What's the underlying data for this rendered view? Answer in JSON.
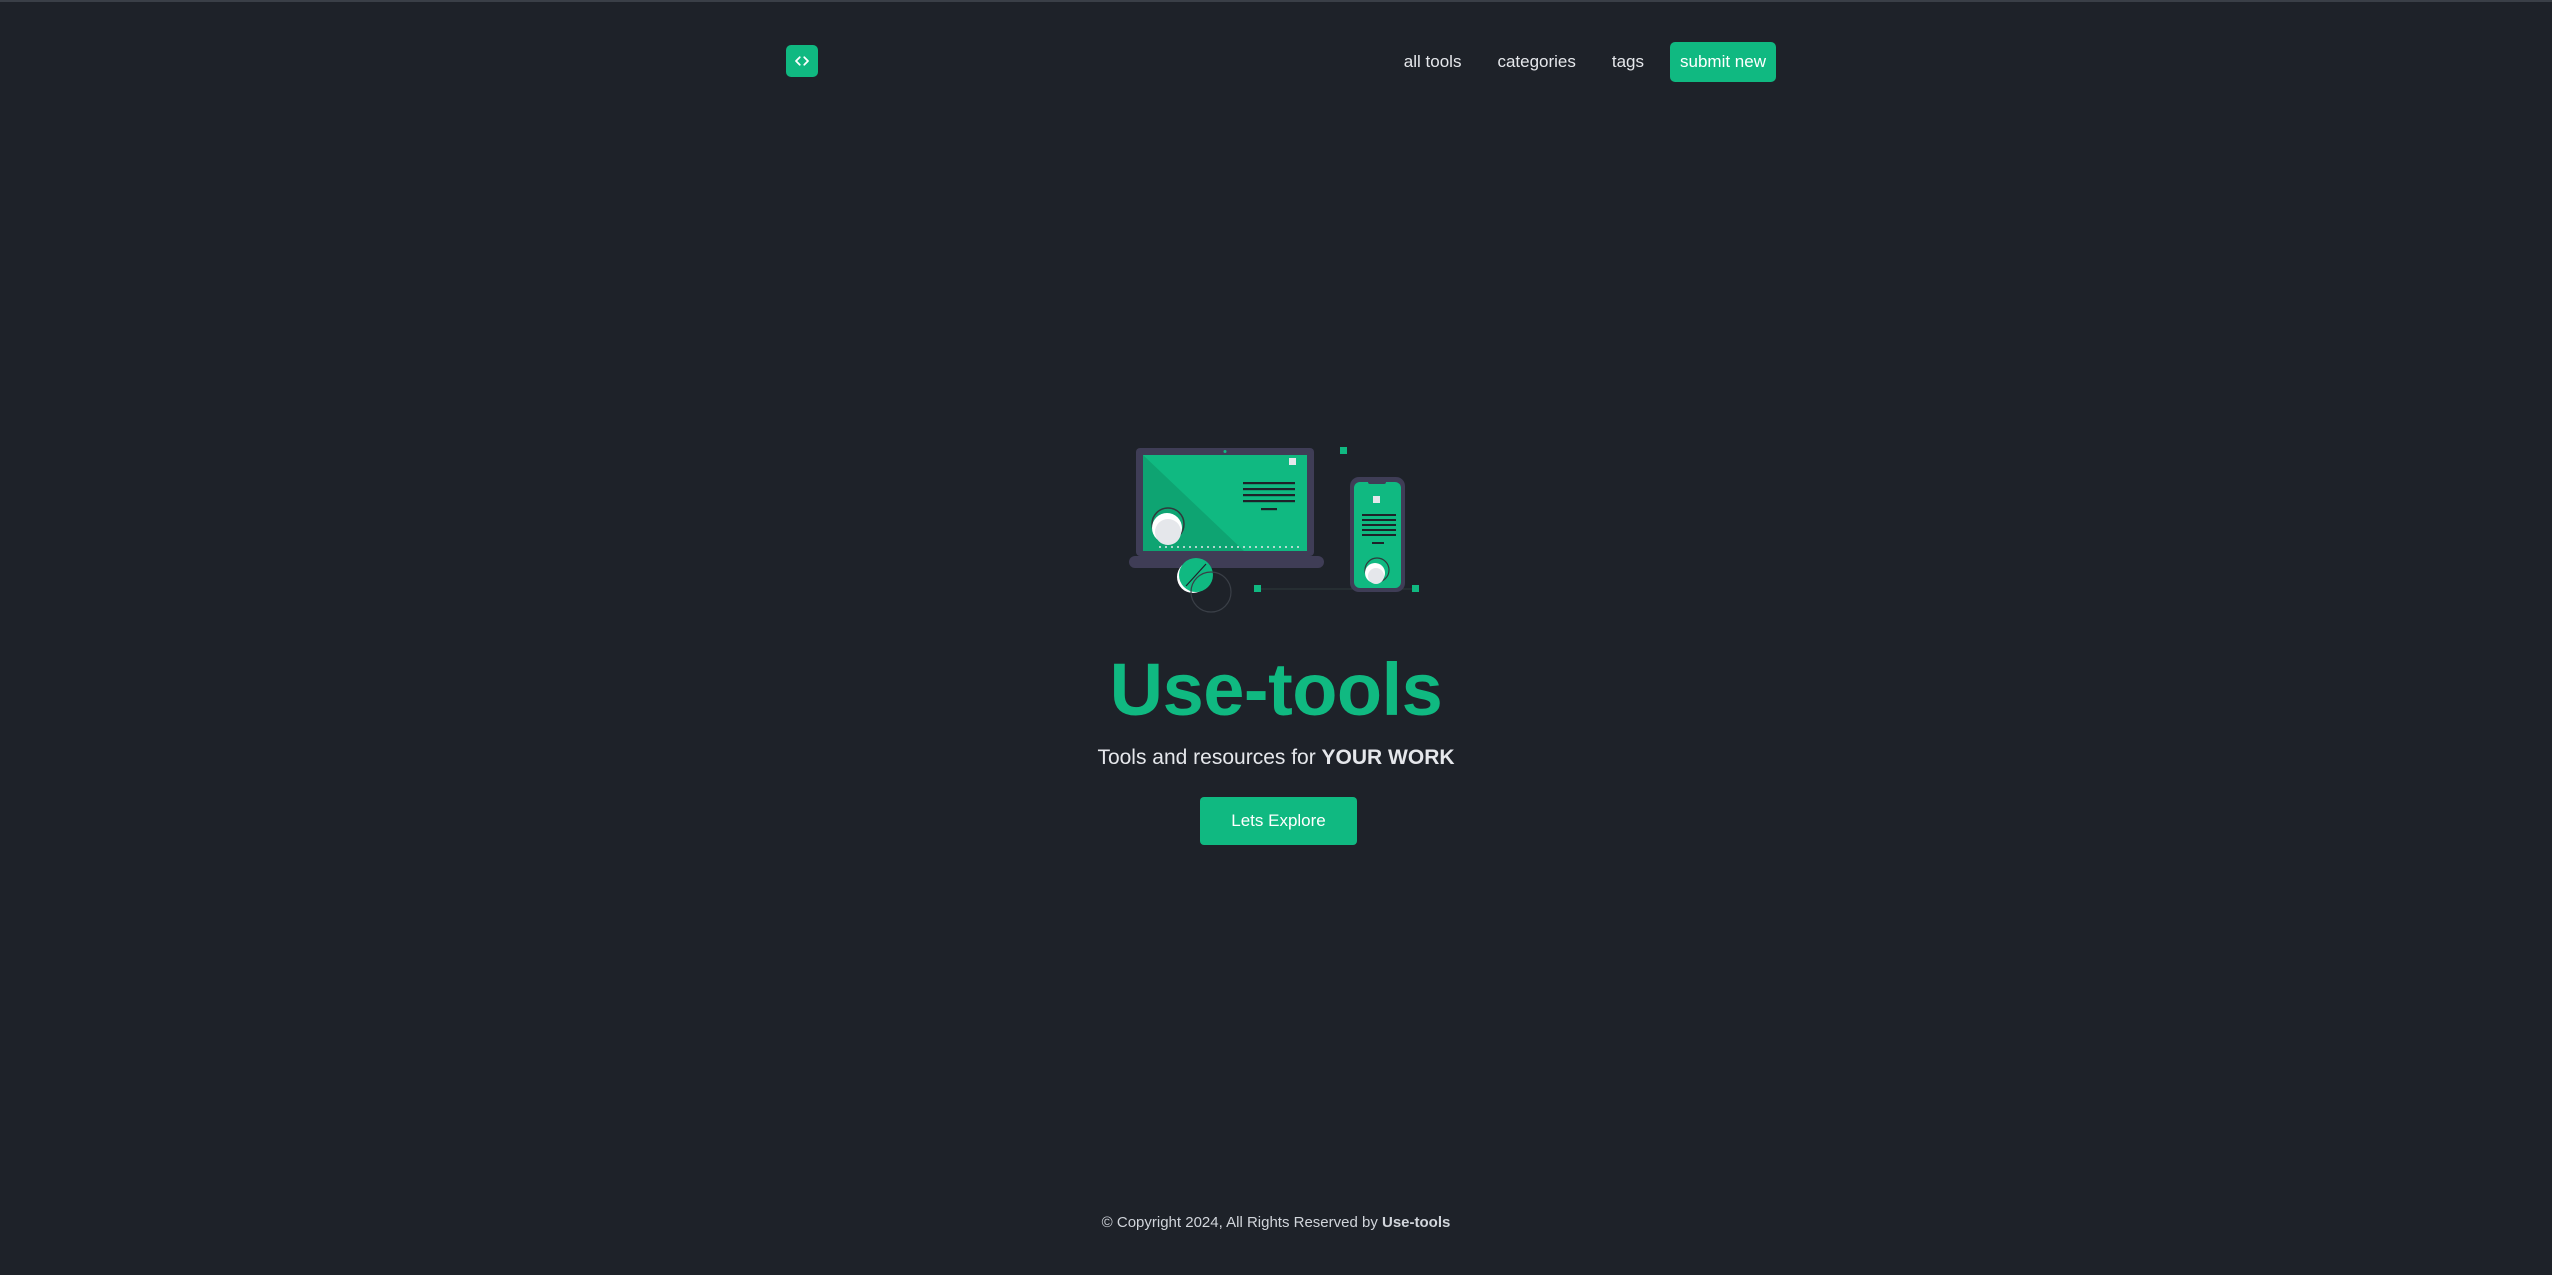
{
  "header": {
    "logo_icon": "code-brackets-icon",
    "nav": [
      {
        "label": "all tools"
      },
      {
        "label": "categories"
      },
      {
        "label": "tags"
      }
    ],
    "submit_label": "submit new"
  },
  "hero": {
    "illustration": "devices-illustration",
    "title": "Use-tools",
    "subtitle_prefix": "Tools and resources for ",
    "subtitle_emphasis": "YOUR WORK",
    "cta_label": "Lets Explore"
  },
  "footer": {
    "copyright_prefix": "© Copyright 2024, All Rights Reserved by ",
    "brand": "Use-tools"
  },
  "colors": {
    "background": "#1e2229",
    "accent": "#10b981",
    "text": "#e5e7eb"
  }
}
